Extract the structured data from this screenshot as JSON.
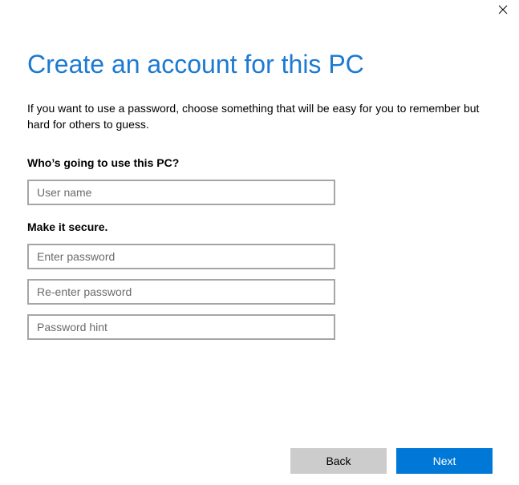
{
  "window": {
    "close_icon": "close-icon"
  },
  "page": {
    "title": "Create an account for this PC",
    "description": "If you want to use a password, choose something that will be easy for you to remember but hard for others to guess."
  },
  "user_section": {
    "label": "Who’s going to use this PC?",
    "username_placeholder": "User name",
    "username_value": ""
  },
  "secure_section": {
    "label": "Make it secure.",
    "password_placeholder": "Enter password",
    "password_value": "",
    "reenter_placeholder": "Re-enter password",
    "reenter_value": "",
    "hint_placeholder": "Password hint",
    "hint_value": ""
  },
  "buttons": {
    "back_label": "Back",
    "next_label": "Next"
  },
  "colors": {
    "title": "#1c7ad2",
    "primary_button": "#0078d7",
    "secondary_button": "#cccccc",
    "input_border": "#a6a6a6"
  }
}
